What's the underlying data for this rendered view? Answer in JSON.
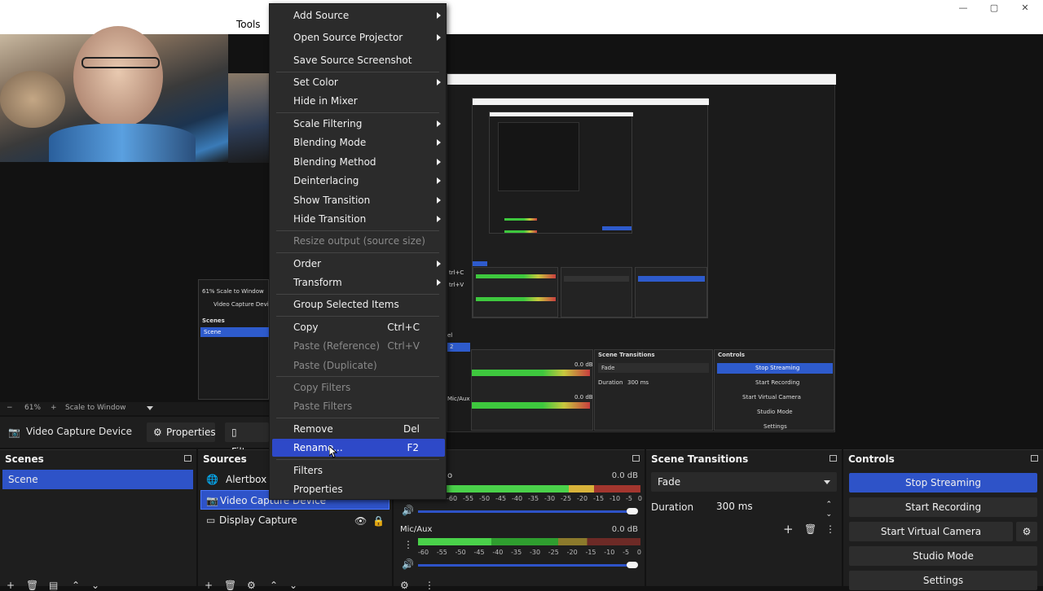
{
  "menubar": {
    "tools": "Tools"
  },
  "window_controls": {
    "minimize": "—",
    "maximize": "▢",
    "close": "✕"
  },
  "context_menu": {
    "items": [
      {
        "label": "Add Source",
        "submenu": true
      },
      {
        "label": "Open Source Projector",
        "submenu": true
      },
      {
        "label": "Save Source Screenshot"
      },
      {
        "label": "Set Color",
        "submenu": true
      },
      {
        "label": "Hide in Mixer"
      },
      {
        "label": "Scale Filtering",
        "submenu": true
      },
      {
        "label": "Blending Mode",
        "submenu": true
      },
      {
        "label": "Blending Method",
        "submenu": true
      },
      {
        "label": "Deinterlacing",
        "submenu": true
      },
      {
        "label": "Show Transition",
        "submenu": true
      },
      {
        "label": "Hide Transition",
        "submenu": true
      },
      {
        "label": "Resize output (source size)",
        "disabled": true
      },
      {
        "label": "Order",
        "submenu": true
      },
      {
        "label": "Transform",
        "submenu": true
      },
      {
        "label": "Group Selected Items"
      },
      {
        "label": "Copy",
        "shortcut": "Ctrl+C"
      },
      {
        "label": "Paste (Reference)",
        "shortcut": "Ctrl+V",
        "disabled": true
      },
      {
        "label": "Paste (Duplicate)",
        "disabled": true
      },
      {
        "label": "Copy Filters",
        "disabled": true
      },
      {
        "label": "Paste Filters",
        "disabled": true
      },
      {
        "label": "Remove",
        "shortcut": "Del"
      },
      {
        "label": "Rename...",
        "shortcut": "F2",
        "highlighted": true
      },
      {
        "label": "Filters"
      },
      {
        "label": "Properties"
      }
    ]
  },
  "preview_toolbar": {
    "minus": "−",
    "zoom": "61%",
    "plus": "+",
    "scale": "Scale to Window"
  },
  "source_toolbar": {
    "name": "Video Capture Device",
    "properties": "Properties",
    "filters": "Filters"
  },
  "scenes": {
    "title": "Scenes",
    "items": [
      "Scene"
    ]
  },
  "sources": {
    "title": "Sources",
    "items": [
      "Alertbox",
      "Video Capture Device",
      "Display Capture"
    ]
  },
  "mixer": {
    "channel1": {
      "name": "o",
      "db": "0.0 dB"
    },
    "channel2": {
      "name": "Mic/Aux",
      "db": "0.0 dB"
    },
    "ticks": [
      "-60",
      "-55",
      "-50",
      "-45",
      "-40",
      "-35",
      "-30",
      "-25",
      "-20",
      "-15",
      "-10",
      "-5",
      "0"
    ]
  },
  "transitions": {
    "title": "Scene Transitions",
    "type": "Fade",
    "duration_label": "Duration",
    "duration": "300 ms"
  },
  "controls": {
    "title": "Controls",
    "stop_streaming": "Stop Streaming",
    "start_recording": "Start Recording",
    "virtual_camera": "Start Virtual Camera",
    "studio_mode": "Studio Mode",
    "settings": "Settings"
  },
  "nested_preview": {
    "zoom": "61%",
    "scale": "Scale to Window",
    "source_name": "Video Capture Device",
    "scenes_title": "Scenes",
    "scene_item": "Scene",
    "transitions_title": "Scene Transitions",
    "transition_type": "Fade",
    "duration_label": "Duration",
    "duration": "300 ms",
    "controls_title": "Controls",
    "stop_streaming": "Stop Streaming",
    "start_recording": "Start Recording",
    "virtual_camera": "Start Virtual Camera",
    "studio_mode": "Studio Mode",
    "settings": "Settings",
    "db1": "0.0 dB",
    "db2": "0.0 dB",
    "mic": "Mic/Aux",
    "copy_shortcut": "trl+C",
    "paste_shortcut": "trl+V",
    "label_el": "el",
    "label_2": "2"
  },
  "colors": {
    "accent": "#2e53c8",
    "menu_highlight": "#2e49c8",
    "panel": "#1e1e1e",
    "bg": "#121212"
  }
}
